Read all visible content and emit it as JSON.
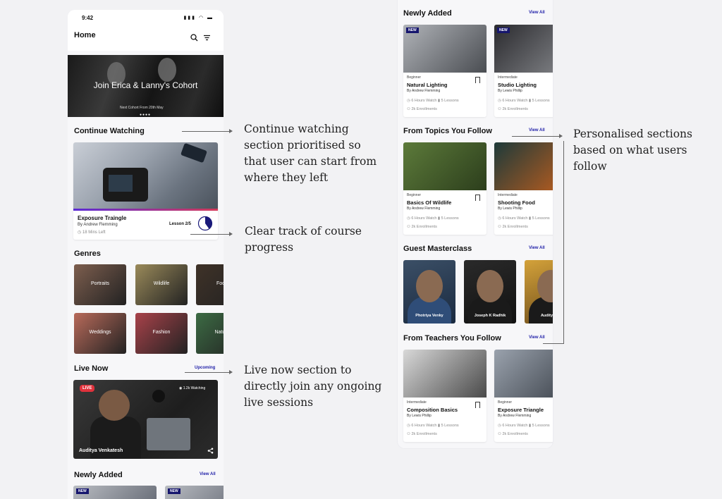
{
  "left_phone": {
    "status_time": "9:42",
    "status_icons": "▮▮▮ ◠ ▬",
    "app_title": "Home",
    "search_icon": "search-icon",
    "filter_icon": "filter-icon",
    "hero_title": "Join Erica & Lanny's Cohort",
    "hero_subtitle": "Next Cohort From 20th May",
    "hero_dots": "●●●●",
    "continue_title": "Continue Watching",
    "continue_card": {
      "title": "Exposure Traingle",
      "author": "By Andrew Flemming",
      "time_left": "18 Mins Left",
      "lesson": "Lesson 2/5",
      "progress": 0.4
    },
    "genres_title": "Genres",
    "genres": [
      {
        "label": "Portraits",
        "color": "#7d5e4e"
      },
      {
        "label": "Wildlife",
        "color": "#9a8a5a"
      },
      {
        "label": "Food",
        "color": "#3f3228"
      },
      {
        "label": "Weddings",
        "color": "#b86a5a"
      },
      {
        "label": "Fashion",
        "color": "#a8424a"
      },
      {
        "label": "Nature",
        "color": "#3c6b44"
      }
    ],
    "live_title": "Live Now",
    "live_link": "Upcoming",
    "live_card": {
      "badge": "LIVE",
      "watching": "◉ 1.2k Watching",
      "name": "Auditya Venkatesh",
      "share_icon": "share-icon"
    },
    "newly_title": "Newly Added",
    "newly_link": "View All",
    "new_badge": "NEW"
  },
  "right_phone": {
    "sections": [
      {
        "title": "Newly Added",
        "link": "View All"
      },
      {
        "title": "From Topics You Follow",
        "link": "View All"
      },
      {
        "title": "Guest Masterclass",
        "link": "View All"
      },
      {
        "title": "From Teachers You Follow",
        "link": "View All"
      }
    ],
    "new_badge": "NEW",
    "courses": [
      {
        "level": "Beginner",
        "title": "Natural Lighting",
        "author": "By Andrew Flemming",
        "meta": "◷ 6 Hours Watch   ▮ 5 Lessons",
        "enroll": "⚇ 2k Enrollments",
        "color1": "#b0b3b8",
        "color2": "#4a4d52"
      },
      {
        "level": "Intermediate",
        "title": "Studio Lighting",
        "author": "By Lewis Phillip",
        "meta": "◷ 6 Hours Watch   ▮ 5 Lessons",
        "enroll": "⚇ 2k Enrollments",
        "color1": "#2a2a2e",
        "color2": "#8a8c90"
      },
      {
        "level": "Beginner",
        "title": "Basics Of Wildlife",
        "author": "By Andrew Flemming",
        "meta": "◷ 6 Hours Watch   ▮ 5 Lessons",
        "enroll": "⚇ 2k Enrollments",
        "color1": "#5c7a3a",
        "color2": "#2c3e1c"
      },
      {
        "level": "Intermediate",
        "title": "Shooting Food",
        "author": "By Lewis Phillip",
        "meta": "◷ 6 Hours Watch   ▮ 5 Lessons",
        "enroll": "⚇ 2k Enrollments",
        "color1": "#1d3a3a",
        "color2": "#c8601c"
      },
      {
        "level": "Intermediate",
        "title": "Composition Basics",
        "author": "By Lewis Phillip",
        "meta": "◷ 6 Hours Watch   ▮ 5 Lessons",
        "enroll": "⚇ 2k Enrollments",
        "color1": "#d8d8d8",
        "color2": "#4a4a4a"
      },
      {
        "level": "Beginner",
        "title": "Exposure Triangle",
        "author": "By Andrew Flemming",
        "meta": "◷ 6 Hours Watch   ▮ 5 Lessons",
        "enroll": "⚇ 2k Enrollments",
        "color1": "#9aa2ad",
        "color2": "#3a4048"
      }
    ],
    "masters": [
      {
        "name": "Photriya Venky",
        "color1": "#3b4f66",
        "color2": "#1a2a40"
      },
      {
        "name": "Joseph K Radhik",
        "color1": "#2a2a2a",
        "color2": "#111111"
      },
      {
        "name": "Auditya Ve",
        "color1": "#d4a23a",
        "color2": "#6a4a1a"
      }
    ]
  },
  "annotations": {
    "continue": "Continue watching section prioritised so that user can start from where they left",
    "progress": "Clear track of course progress",
    "live": "Live now section to directly join any ongoing live sessions",
    "personalised": "Personalised sections based on what users follow"
  }
}
